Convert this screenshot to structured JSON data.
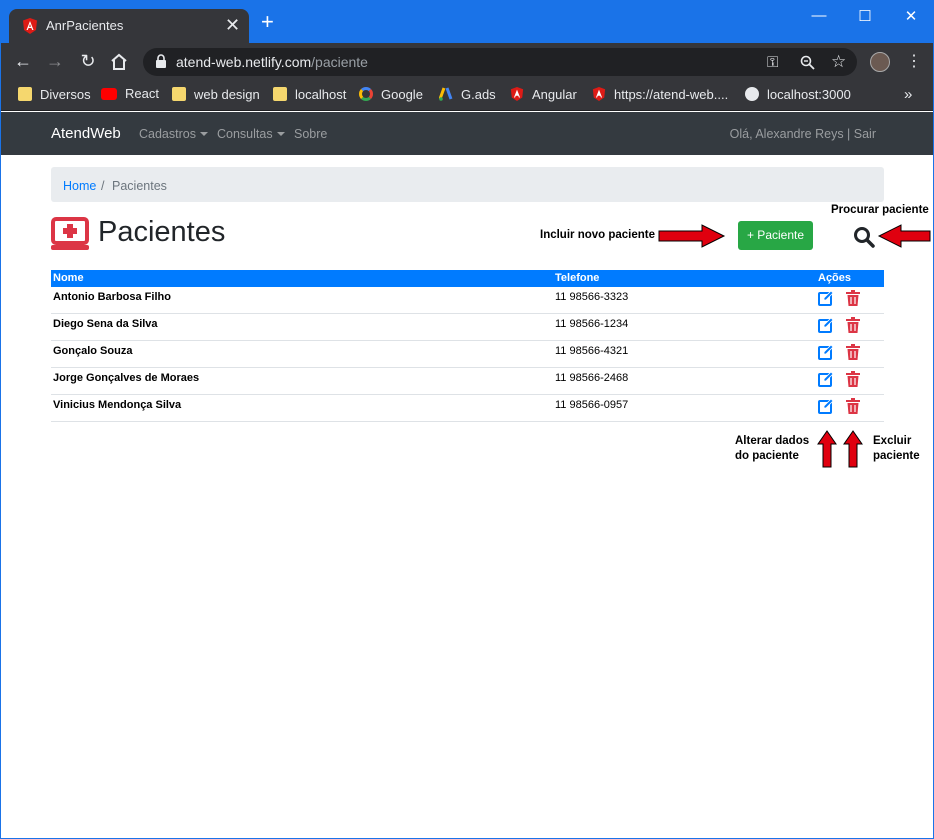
{
  "browser": {
    "tab_title": "AnrPacientes",
    "tab_close": "✕",
    "new_tab": "+",
    "url_host": "atend-web.netlify.com",
    "url_path": "/paciente",
    "bookmarks": [
      {
        "label": "Diversos",
        "icon": "folder-icon"
      },
      {
        "label": "React",
        "icon": "youtube-icon"
      },
      {
        "label": "web design",
        "icon": "folder-icon"
      },
      {
        "label": "localhost",
        "icon": "folder-icon"
      },
      {
        "label": "Google",
        "icon": "google-icon"
      },
      {
        "label": "G.ads",
        "icon": "google-ads-icon"
      },
      {
        "label": "Angular",
        "icon": "angular-icon"
      },
      {
        "label": "https://atend-web....",
        "icon": "angular-icon"
      },
      {
        "label": "localhost:3000",
        "icon": "globe-icon"
      }
    ],
    "more_bookmarks": "»"
  },
  "navbar": {
    "brand": "AtendWeb",
    "items": [
      {
        "label": "Cadastros",
        "dropdown": true
      },
      {
        "label": "Consultas",
        "dropdown": true
      },
      {
        "label": "Sobre",
        "dropdown": false
      }
    ],
    "user": "Olá, Alexandre Reys | Sair"
  },
  "breadcrumb": {
    "home": "Home",
    "separator": "/",
    "current": "Pacientes"
  },
  "page": {
    "title": "Pacientes",
    "add_button": "+ Paciente"
  },
  "annotations": {
    "add": "Incluir novo paciente",
    "search": "Procurar paciente",
    "edit_line1": "Alterar dados",
    "edit_line2": "do paciente",
    "delete_line1": "Excluir",
    "delete_line2": "paciente"
  },
  "table": {
    "headers": {
      "name": "Nome",
      "phone": "Telefone",
      "actions": "Ações"
    },
    "rows": [
      {
        "name": "Antonio Barbosa Filho",
        "phone": "11 98566-3323"
      },
      {
        "name": "Diego Sena da Silva",
        "phone": "11 98566-1234"
      },
      {
        "name": "Gonçalo Souza",
        "phone": "11 98566-4321"
      },
      {
        "name": "Jorge Gonçalves de Moraes",
        "phone": "11 98566-2468"
      },
      {
        "name": "Vinicius Mendonça Silva",
        "phone": "11 98566-0957"
      }
    ]
  },
  "colors": {
    "titlebar": "#1a73e8",
    "navbar": "#343a40",
    "table_header": "#007bff",
    "add_button": "#28a745",
    "edit_icon": "#007bff",
    "delete_icon": "#dc3545",
    "arrow": "#e0000f"
  }
}
